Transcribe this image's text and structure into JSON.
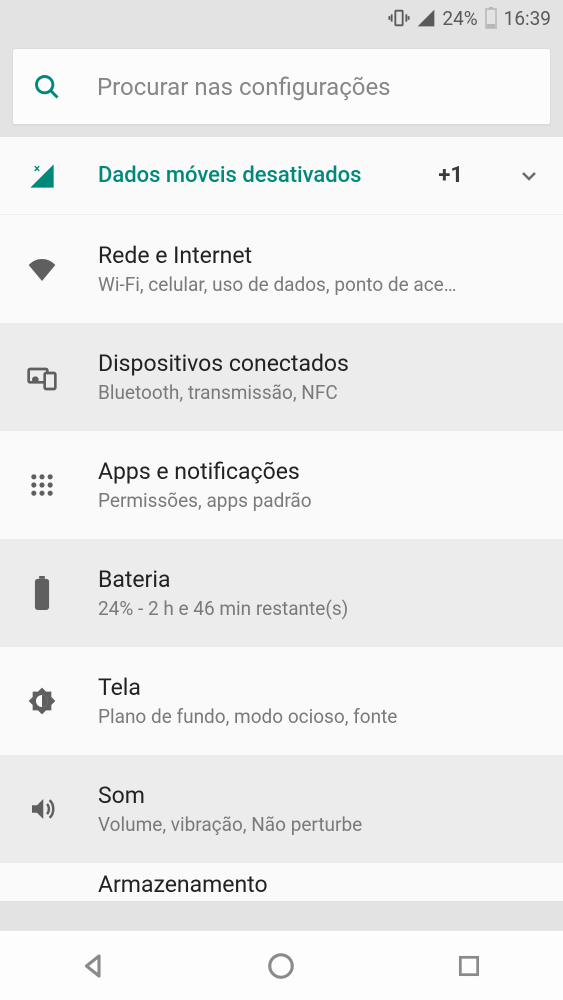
{
  "status_bar": {
    "battery_pct": "24%",
    "time": "16:39"
  },
  "search": {
    "placeholder": "Procurar nas configurações"
  },
  "suggestion": {
    "text": "Dados móveis desativados",
    "badge": "+1"
  },
  "items": [
    {
      "title": "Rede e Internet",
      "subtitle": "Wi-Fi, celular, uso de dados, ponto de ace…"
    },
    {
      "title": "Dispositivos conectados",
      "subtitle": "Bluetooth, transmissão, NFC"
    },
    {
      "title": "Apps e notificações",
      "subtitle": "Permissões, apps padrão"
    },
    {
      "title": "Bateria",
      "subtitle": "24% - 2 h e 46 min restante(s)"
    },
    {
      "title": "Tela",
      "subtitle": "Plano de fundo, modo ocioso, fonte"
    },
    {
      "title": "Som",
      "subtitle": "Volume, vibração, Não perturbe"
    }
  ],
  "partial": {
    "title": "Armazenamento"
  }
}
